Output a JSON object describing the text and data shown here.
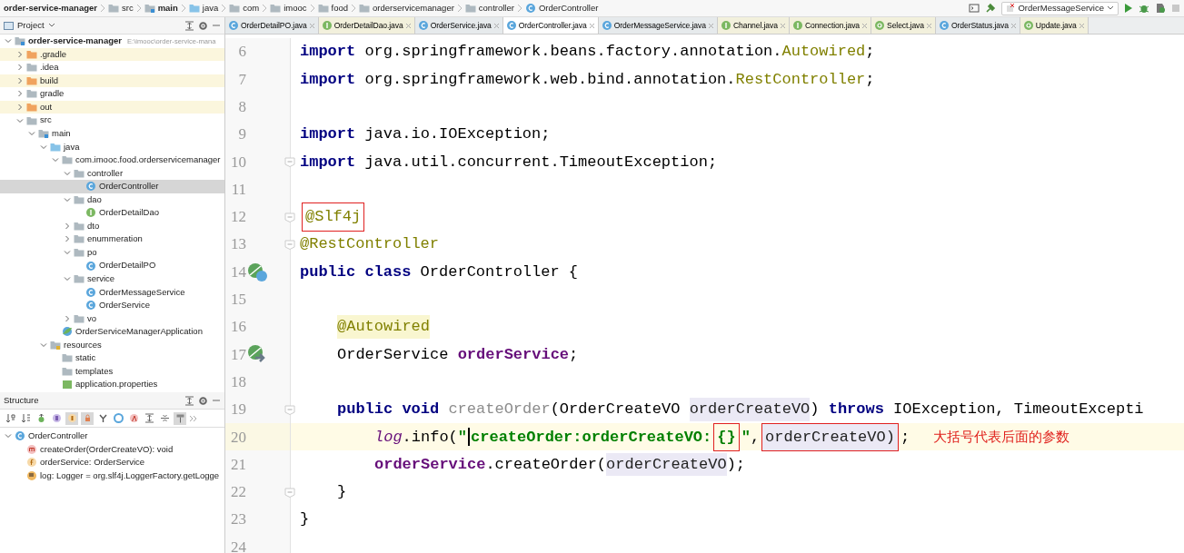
{
  "breadcrumbs": [
    {
      "label": "order-service-manager",
      "kind": "none",
      "bold": true
    },
    {
      "label": "src",
      "kind": "folder",
      "bold": false
    },
    {
      "label": "main",
      "kind": "src",
      "bold": true
    },
    {
      "label": "java",
      "kind": "folder-blue",
      "bold": false
    },
    {
      "label": "com",
      "kind": "folder",
      "bold": false
    },
    {
      "label": "imooc",
      "kind": "folder",
      "bold": false
    },
    {
      "label": "food",
      "kind": "folder",
      "bold": false
    },
    {
      "label": "orderservicemanager",
      "kind": "folder",
      "bold": false
    },
    {
      "label": "controller",
      "kind": "folder",
      "bold": false
    },
    {
      "label": "OrderController",
      "kind": "class",
      "bold": false
    }
  ],
  "run_config": "OrderMessageService",
  "project_panel": {
    "title": "Project"
  },
  "tree": [
    {
      "label": "order-service-manager",
      "hint": "E:\\imooc\\order-service-mana",
      "kind": "module",
      "expanded": true,
      "selected": false,
      "children": [
        {
          "label": ".gradle",
          "kind": "excluded",
          "expanded": false,
          "selected": false
        },
        {
          "label": ".idea",
          "kind": "folder",
          "expanded": false,
          "selected": false
        },
        {
          "label": "build",
          "kind": "excluded",
          "expanded": false,
          "selected": false
        },
        {
          "label": "gradle",
          "kind": "folder",
          "expanded": false,
          "selected": false
        },
        {
          "label": "out",
          "kind": "excluded",
          "expanded": false,
          "selected": false
        },
        {
          "label": "src",
          "kind": "folder",
          "expanded": true,
          "selected": false,
          "children": [
            {
              "label": "main",
              "kind": "src",
              "expanded": true,
              "selected": false,
              "children": [
                {
                  "label": "java",
                  "kind": "folder-blue",
                  "expanded": true,
                  "selected": false,
                  "children": [
                    {
                      "label": "com.imooc.food.orderservicemanager",
                      "kind": "folder",
                      "expanded": true,
                      "selected": false,
                      "children": [
                        {
                          "label": "controller",
                          "kind": "folder",
                          "expanded": true,
                          "selected": false,
                          "children": [
                            {
                              "label": "OrderController",
                              "kind": "class",
                              "selected": true
                            }
                          ]
                        },
                        {
                          "label": "dao",
                          "kind": "folder",
                          "expanded": true,
                          "selected": false,
                          "children": [
                            {
                              "label": "OrderDetailDao",
                              "kind": "interface",
                              "selected": false
                            }
                          ]
                        },
                        {
                          "label": "dto",
                          "kind": "folder",
                          "expanded": false,
                          "selected": false
                        },
                        {
                          "label": "enummeration",
                          "kind": "folder",
                          "expanded": false,
                          "selected": false
                        },
                        {
                          "label": "po",
                          "kind": "folder",
                          "expanded": true,
                          "selected": false,
                          "children": [
                            {
                              "label": "OrderDetailPO",
                              "kind": "class",
                              "selected": false
                            }
                          ]
                        },
                        {
                          "label": "service",
                          "kind": "folder",
                          "expanded": true,
                          "selected": false,
                          "children": [
                            {
                              "label": "OrderMessageService",
                              "kind": "class",
                              "selected": false
                            },
                            {
                              "label": "OrderService",
                              "kind": "class",
                              "selected": false
                            }
                          ]
                        },
                        {
                          "label": "vo",
                          "kind": "folder",
                          "expanded": false,
                          "selected": false
                        }
                      ]
                    },
                    {
                      "label": "OrderServiceManagerApplication",
                      "kind": "app",
                      "selected": false
                    }
                  ]
                },
                {
                  "label": "resources",
                  "kind": "resources",
                  "expanded": true,
                  "selected": false,
                  "children": [
                    {
                      "label": "static",
                      "kind": "folder",
                      "selected": false
                    },
                    {
                      "label": "templates",
                      "kind": "folder",
                      "selected": false
                    },
                    {
                      "label": "application.properties",
                      "kind": "props",
                      "selected": false
                    }
                  ]
                }
              ]
            }
          ]
        }
      ]
    }
  ],
  "structure_panel": {
    "title": "Structure",
    "toggles": [
      {
        "on": false
      },
      {
        "on": false
      },
      {
        "on": false
      },
      {
        "on": false
      },
      {
        "on": true
      },
      {
        "on": true
      },
      {
        "on": false
      },
      {
        "on": false
      },
      {
        "on": false
      },
      {
        "on": false
      },
      {
        "on": false
      },
      {
        "on": true
      }
    ],
    "tree": [
      {
        "label": "OrderController",
        "kind": "class",
        "expanded": true,
        "children": [
          {
            "label": "createOrder(OrderCreateVO): void",
            "kind": "method"
          },
          {
            "label": "orderService: OrderService",
            "kind": "field"
          },
          {
            "label": "log: Logger = org.slf4j.LoggerFactory.getLogge",
            "kind": "static-field"
          }
        ]
      }
    ]
  },
  "tabs": [
    {
      "label": "OrderDetailPO.java",
      "kind": "class",
      "selected": false
    },
    {
      "label": "OrderDetailDao.java",
      "kind": "interface",
      "selected": false
    },
    {
      "label": "OrderService.java",
      "kind": "class",
      "selected": false
    },
    {
      "label": "OrderController.java",
      "kind": "class",
      "selected": true
    },
    {
      "label": "OrderMessageService.java",
      "kind": "class",
      "selected": false
    },
    {
      "label": "Channel.java",
      "kind": "interface",
      "selected": false
    },
    {
      "label": "Connection.java",
      "kind": "interface",
      "selected": false
    },
    {
      "label": "Select.java",
      "kind": "annotation",
      "selected": false
    },
    {
      "label": "OrderStatus.java",
      "kind": "class",
      "selected": false
    },
    {
      "label": "Update.java",
      "kind": "annotation",
      "selected": false
    }
  ],
  "code": [
    {
      "number": "6",
      "tokens": [
        {
          "kind": "kw",
          "text": "import"
        },
        {
          "kind": "plain",
          "text": " org.springframework.beans.factory.annotation."
        },
        {
          "kind": "ann",
          "text": "Autowired"
        },
        {
          "kind": "plain",
          "text": ";"
        }
      ]
    },
    {
      "number": "7",
      "tokens": [
        {
          "kind": "kw",
          "text": "import"
        },
        {
          "kind": "plain",
          "text": " org.springframework.web.bind.annotation."
        },
        {
          "kind": "ann",
          "text": "RestController"
        },
        {
          "kind": "plain",
          "text": ";"
        }
      ]
    },
    {
      "number": "8"
    },
    {
      "number": "9",
      "tokens": [
        {
          "kind": "kw",
          "text": "import"
        },
        {
          "kind": "plain",
          "text": " java.io.IOException;"
        }
      ]
    },
    {
      "number": "10",
      "fold": true,
      "tokens": [
        {
          "kind": "kw",
          "text": "import"
        },
        {
          "kind": "plain",
          "text": " java.util.concurrent.TimeoutException;"
        }
      ]
    },
    {
      "number": "11"
    },
    {
      "number": "12",
      "fold": true,
      "tokens": [
        {
          "kind": "ann",
          "text": "@Slf4j",
          "boxed": true
        }
      ]
    },
    {
      "number": "13",
      "fold": true,
      "tokens": [
        {
          "kind": "ann",
          "text": "@RestController"
        }
      ]
    },
    {
      "number": "14",
      "gutter": {
        "kind": "bean-class"
      },
      "tokens": [
        {
          "kind": "kw",
          "text": "public class"
        },
        {
          "kind": "plain",
          "text": " OrderController {"
        }
      ]
    },
    {
      "number": "15"
    },
    {
      "number": "16",
      "kind": "block",
      "tokens": [
        {
          "kind": "ann-hl",
          "text": "@Autowired"
        }
      ]
    },
    {
      "number": "17",
      "kind": "block",
      "gutter": {
        "kind": "bean-inject"
      },
      "tokens": [
        {
          "kind": "plain",
          "text": "OrderService "
        },
        {
          "kind": "field",
          "text": "orderService"
        },
        {
          "kind": "plain",
          "text": ";"
        }
      ]
    },
    {
      "number": "18"
    },
    {
      "number": "19",
      "kind": "block",
      "fold": true,
      "tokens": [
        {
          "kind": "kw",
          "text": "public void "
        },
        {
          "kind": "unused",
          "text": "createOrder"
        },
        {
          "kind": "plain",
          "text": "(OrderCreateVO "
        },
        {
          "kind": "param",
          "text": "orderCreateVO"
        },
        {
          "kind": "plain",
          "text": ") "
        },
        {
          "kind": "kw",
          "text": "throws"
        },
        {
          "kind": "plain",
          "text": " IOException, TimeoutExcepti"
        }
      ]
    },
    {
      "number": "20",
      "kind": "body",
      "current": true,
      "tokens": [
        {
          "kind": "static",
          "text": "log"
        },
        {
          "kind": "plain",
          "text": ".info("
        },
        {
          "kind": "str",
          "text": "\""
        },
        {
          "kind": "caret"
        },
        {
          "kind": "str",
          "text": "createOrder:orderCreateVO:"
        },
        {
          "kind": "str",
          "text": "{}",
          "boxed": true
        },
        {
          "kind": "str",
          "text": "\""
        },
        {
          "kind": "plain",
          "text": ","
        },
        {
          "kind": "param",
          "text": "orderCreateVO)",
          "boxed": true
        },
        {
          "kind": "plain",
          "text": ";"
        }
      ],
      "note": "大括号代表后面的参数"
    },
    {
      "number": "21",
      "kind": "body",
      "tokens": [
        {
          "kind": "field",
          "text": "orderService"
        },
        {
          "kind": "plain",
          "text": ".createOrder("
        },
        {
          "kind": "param",
          "text": "orderCreateVO"
        },
        {
          "kind": "plain",
          "text": ");"
        }
      ]
    },
    {
      "number": "22",
      "kind": "block",
      "fold": true,
      "tokens": [
        {
          "kind": "plain",
          "text": "}"
        }
      ]
    },
    {
      "number": "23",
      "tokens": [
        {
          "kind": "plain",
          "text": "}"
        }
      ]
    },
    {
      "number": "24"
    }
  ]
}
